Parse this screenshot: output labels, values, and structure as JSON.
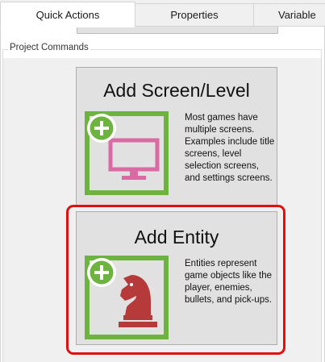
{
  "tabs": [
    {
      "label": "Quick Actions",
      "active": true
    },
    {
      "label": "Properties",
      "active": false
    },
    {
      "label": "Variable",
      "active": false
    }
  ],
  "group": {
    "title": "Project Commands"
  },
  "cards": [
    {
      "title": "Add Screen/Level",
      "description": "Most games have multiple screens. Examples include title screens, level selection screens, and settings screens.",
      "icon": "monitor-plus-icon"
    },
    {
      "title": "Add Entity",
      "description": "Entities represent game objects like the player, enemies, bullets, and pick-ups.",
      "icon": "chess-knight-plus-icon",
      "highlighted": true
    }
  ],
  "colors": {
    "icon_frame_green": "#6cb33f",
    "monitor_pink": "#d96aa3",
    "knight_red": "#b73a3a",
    "highlight_red": "#e01010"
  }
}
